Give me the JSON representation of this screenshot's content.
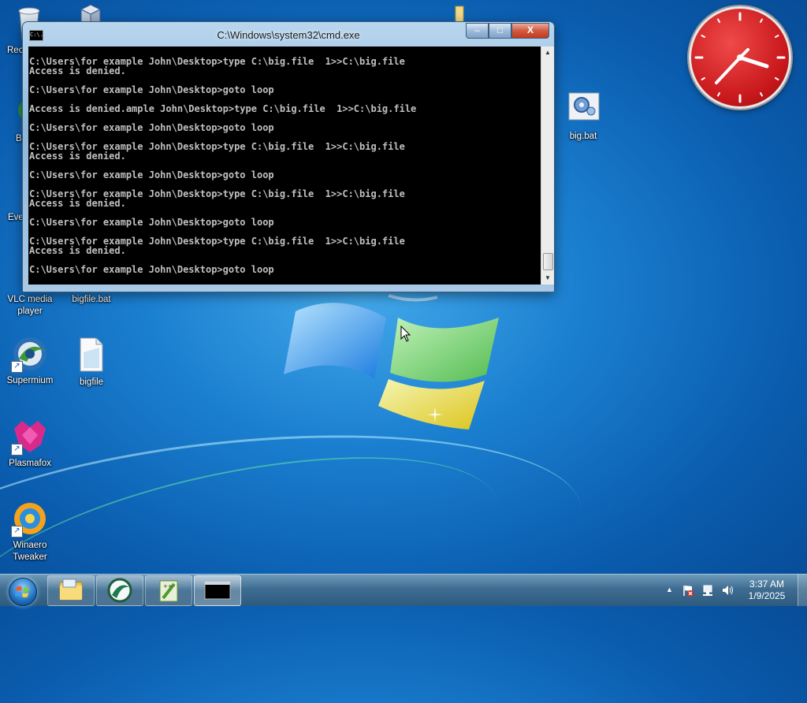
{
  "desktop": {
    "icons": [
      {
        "label": "Recy",
        "icon": "recycle-bin-icon"
      },
      {
        "label": "",
        "icon": "virtualbox-icon"
      },
      {
        "label": "",
        "icon": "folder-icon"
      },
      {
        "label": "Bas",
        "icon": "basilisk-icon"
      },
      {
        "label": "Ever",
        "icon": "everything-icon"
      },
      {
        "label": "VLC media player",
        "icon": "vlc-icon"
      },
      {
        "label": "bigfile.bat",
        "icon": "batch-file-icon"
      },
      {
        "label": "big.bat",
        "icon": "batch-file-icon"
      },
      {
        "label": "Supermium",
        "icon": "supermium-icon"
      },
      {
        "label": "bigfile",
        "icon": "file-icon"
      },
      {
        "label": "Plasmafox",
        "icon": "plasmafox-icon"
      },
      {
        "label": "Winaero Tweaker",
        "icon": "winaero-icon"
      }
    ]
  },
  "cmd_window": {
    "title": "C:\\Windows\\system32\\cmd.exe",
    "minimize": "–",
    "maximize": "□",
    "close": "X",
    "lines": [
      "C:\\Users\\for example John\\Desktop>type C:\\big.file  1>>C:\\big.file",
      "Access is denied.",
      "",
      "C:\\Users\\for example John\\Desktop>goto loop",
      "",
      "Access is denied.ample John\\Desktop>type C:\\big.file  1>>C:\\big.file",
      "",
      "C:\\Users\\for example John\\Desktop>goto loop",
      "",
      "C:\\Users\\for example John\\Desktop>type C:\\big.file  1>>C:\\big.file",
      "Access is denied.",
      "",
      "C:\\Users\\for example John\\Desktop>goto loop",
      "",
      "C:\\Users\\for example John\\Desktop>type C:\\big.file  1>>C:\\big.file",
      "Access is denied.",
      "",
      "C:\\Users\\for example John\\Desktop>goto loop",
      "",
      "C:\\Users\\for example John\\Desktop>type C:\\big.file  1>>C:\\big.file",
      "Access is denied.",
      "",
      "C:\\Users\\for example John\\Desktop>goto loop"
    ],
    "icon_text": "C:\\."
  },
  "gadget": {
    "type": "clock",
    "hour": 3,
    "minute": 37
  },
  "taskbar": {
    "start": "start-orb-icon",
    "pinned": [
      {
        "icon": "explorer-folder-icon"
      },
      {
        "icon": "supermium-icon"
      },
      {
        "icon": "notepad-plus-plus-icon"
      },
      {
        "icon": "cmd-icon",
        "text": "C:\\."
      }
    ],
    "tray": {
      "show_hidden": "▲",
      "time": "3:37 AM",
      "date": "1/9/2025"
    }
  }
}
